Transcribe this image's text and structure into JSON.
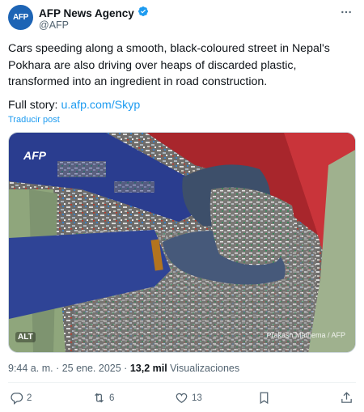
{
  "account": {
    "avatar_text": "AFP",
    "name": "AFP News Agency",
    "handle": "@AFP",
    "verified_color": "#1d9bf0",
    "more_icon": "more-icon"
  },
  "tweet": {
    "text": "Cars speeding along a smooth, black-coloured street in Nepal's Pokhara are also driving over heaps of discarded plastic, transformed into an ingredient in road construction.",
    "full_story_label": "Full story: ",
    "full_story_link": "u.afp.com/Skyp",
    "translate_label": "Traducir post"
  },
  "media": {
    "logo_text": "AFP",
    "alt_badge": "ALT",
    "credit": "Prakash Mathema / AFP"
  },
  "meta": {
    "time": "9:44 a. m.",
    "sep1": " · ",
    "date": "25 ene. 2025",
    "sep2": " · ",
    "views_count": "13,2 mil",
    "views_label": " Visualizaciones"
  },
  "actions": {
    "replies": "2",
    "reposts": "6",
    "likes": "13"
  },
  "colors": {
    "link": "#1d9bf0",
    "muted": "#536471",
    "text": "#0f1419"
  }
}
